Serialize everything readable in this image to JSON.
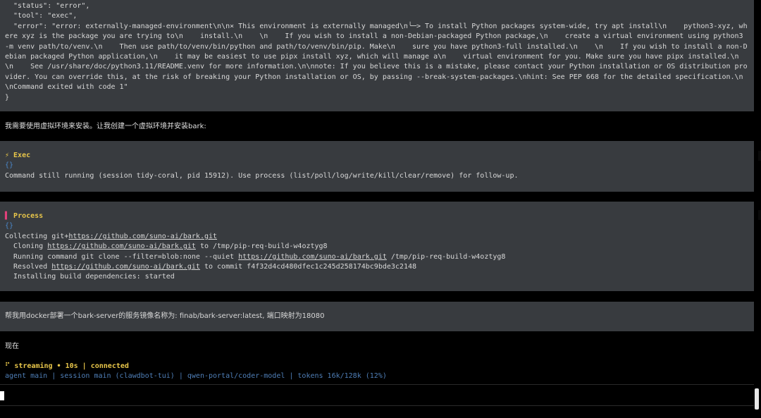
{
  "error_block": {
    "lines": [
      "  \"status\": \"error\",",
      "  \"tool\": \"exec\",",
      "  \"error\": \"error: externally-managed-environment\\n\\n× This environment is externally managed\\n╰─> To install Python packages system-wide, try apt install\\n    python3-xyz, where xyz is the package you are trying to\\n    install.\\n    \\n    If you wish to install a non-Debian-packaged Python package,\\n    create a virtual environment using python3 -m venv path/to/venv.\\n    Then use path/to/venv/bin/python and path/to/venv/bin/pip. Make\\n    sure you have python3-full installed.\\n    \\n    If you wish to install a non-Debian packaged Python application,\\n    it may be easiest to use pipx install xyz, which will manage a\\n    virtual environment for you. Make sure you have pipx installed.\\n    \\n    See /usr/share/doc/python3.11/README.venv for more information.\\n\\nnote: If you believe this is a mistake, please contact your Python installation or OS distribution provider. You can override this, at the risk of breaking your Python installation or OS, by passing --break-system-packages.\\nhint: See PEP 668 for the detailed specification.\\n\\nCommand exited with code 1\"",
      "}"
    ]
  },
  "assistant_message_1": "我需要使用虚拟环境来安装。让我创建一个虚拟环境并安装bark:",
  "exec_block": {
    "header": "⚡ Exec",
    "braces": "{}",
    "text": "Command still running (session tidy-coral, pid 15912). Use process (list/poll/log/write/kill/clear/remove) for follow-up."
  },
  "process_block": {
    "header": "▌ Process",
    "braces": "{}",
    "line1_prefix": "Collecting git+",
    "line1_link": "https://github.com/suno-ai/bark.git",
    "line2_prefix": "  Cloning ",
    "line2_link": "https://github.com/suno-ai/bark.git",
    "line2_suffix": " to /tmp/pip-req-build-w4oztyg8",
    "line3_prefix": "  Running command git clone --filter=blob:none --quiet ",
    "line3_link": "https://github.com/suno-ai/bark.git",
    "line3_suffix": " /tmp/pip-req-build-w4oztyg8",
    "line4_prefix": "  Resolved ",
    "line4_link": "https://github.com/suno-ai/bark.git",
    "line4_suffix": " to commit f4f32d4cd480dfec1c245d258174bc9bde3c2148",
    "line5": "  Installing build dependencies: started"
  },
  "user_message": "帮我用docker部署一个bark-server的服务镜像名称为: finab/bark-server:latest, 端口映射为18080",
  "assistant_message_2": "现在",
  "streaming_line": "⠋ streaming • 10s | connected",
  "status_bar": "agent main | session main (clawdbot-tui) | qwen-portal/coder-model | tokens 16k/128k (12%)"
}
